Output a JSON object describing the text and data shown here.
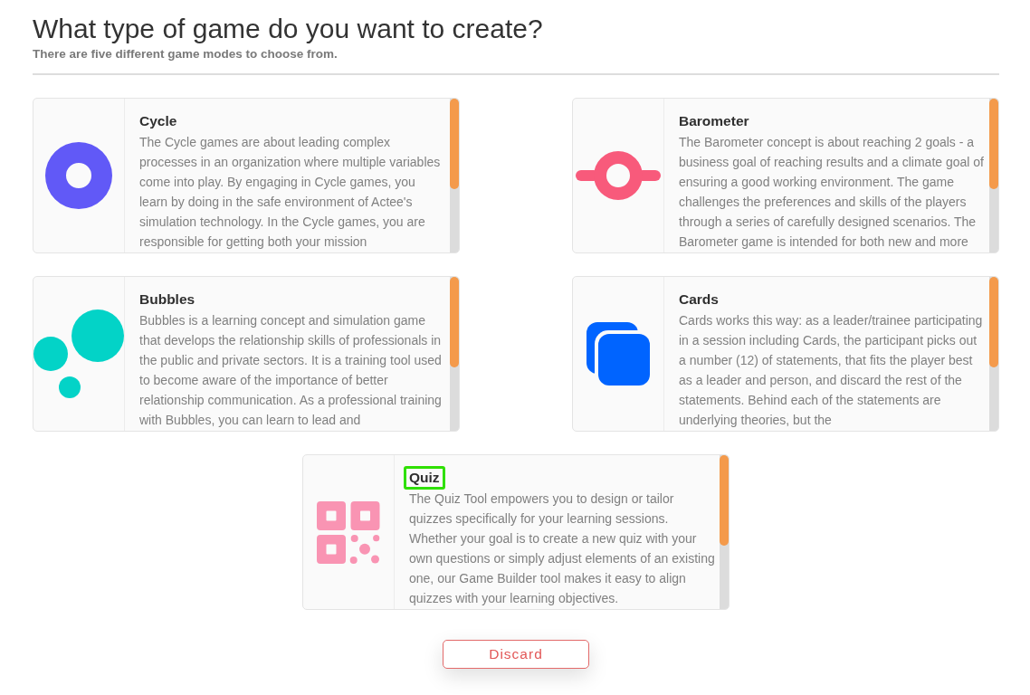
{
  "page": {
    "title": "What type of game do you want to create?",
    "subtitle": "There are five different game modes to choose from."
  },
  "modes": [
    {
      "kind": "donut",
      "color": "#6159f7",
      "title": "Cycle",
      "highlighted": false,
      "description": "The Cycle games are about leading complex processes in an organization where multiple variables come into play. By engaging in Cycle games, you learn by doing in the safe environment of Actee's simulation technology. In the Cycle games, you are responsible for getting both your mission"
    },
    {
      "kind": "gauge",
      "color": "#f85a7b",
      "title": "Barometer",
      "highlighted": false,
      "description": "The Barometer concept is about reaching 2 goals - a business goal of reaching results and a climate goal of ensuring a good working environment. The game challenges the preferences and skills of the players through a series of carefully designed scenarios. The Barometer game is intended for both new and more"
    },
    {
      "kind": "bubbles",
      "color": "#03d3c7",
      "title": "Bubbles",
      "highlighted": false,
      "description": "Bubbles is a learning concept and simulation game that develops the relationship skills of professionals in the public and private sectors. It is a training tool used to become aware of the importance of better relationship communication. As a professional training with Bubbles, you can learn to lead and"
    },
    {
      "kind": "stack",
      "color": "#0064ff",
      "title": "Cards",
      "highlighted": false,
      "description": "Cards works this way: as a leader/trainee participating in a session including Cards, the participant picks out a number (12) of statements, that fits the player best as a leader and person, and discard the rest of the statements. Behind each of the statements are underlying theories, but the"
    },
    {
      "kind": "grid",
      "color": "#f994b3",
      "title": "Quiz",
      "highlighted": true,
      "description": "The Quiz Tool empowers you to design or tailor quizzes specifically for your learning sessions. Whether your goal is to create a new quiz with your own questions or simply adjust elements of an existing one, our Game Builder tool makes it easy to align quizzes with your learning objectives."
    }
  ],
  "discard_button": {
    "label": "Discard"
  }
}
